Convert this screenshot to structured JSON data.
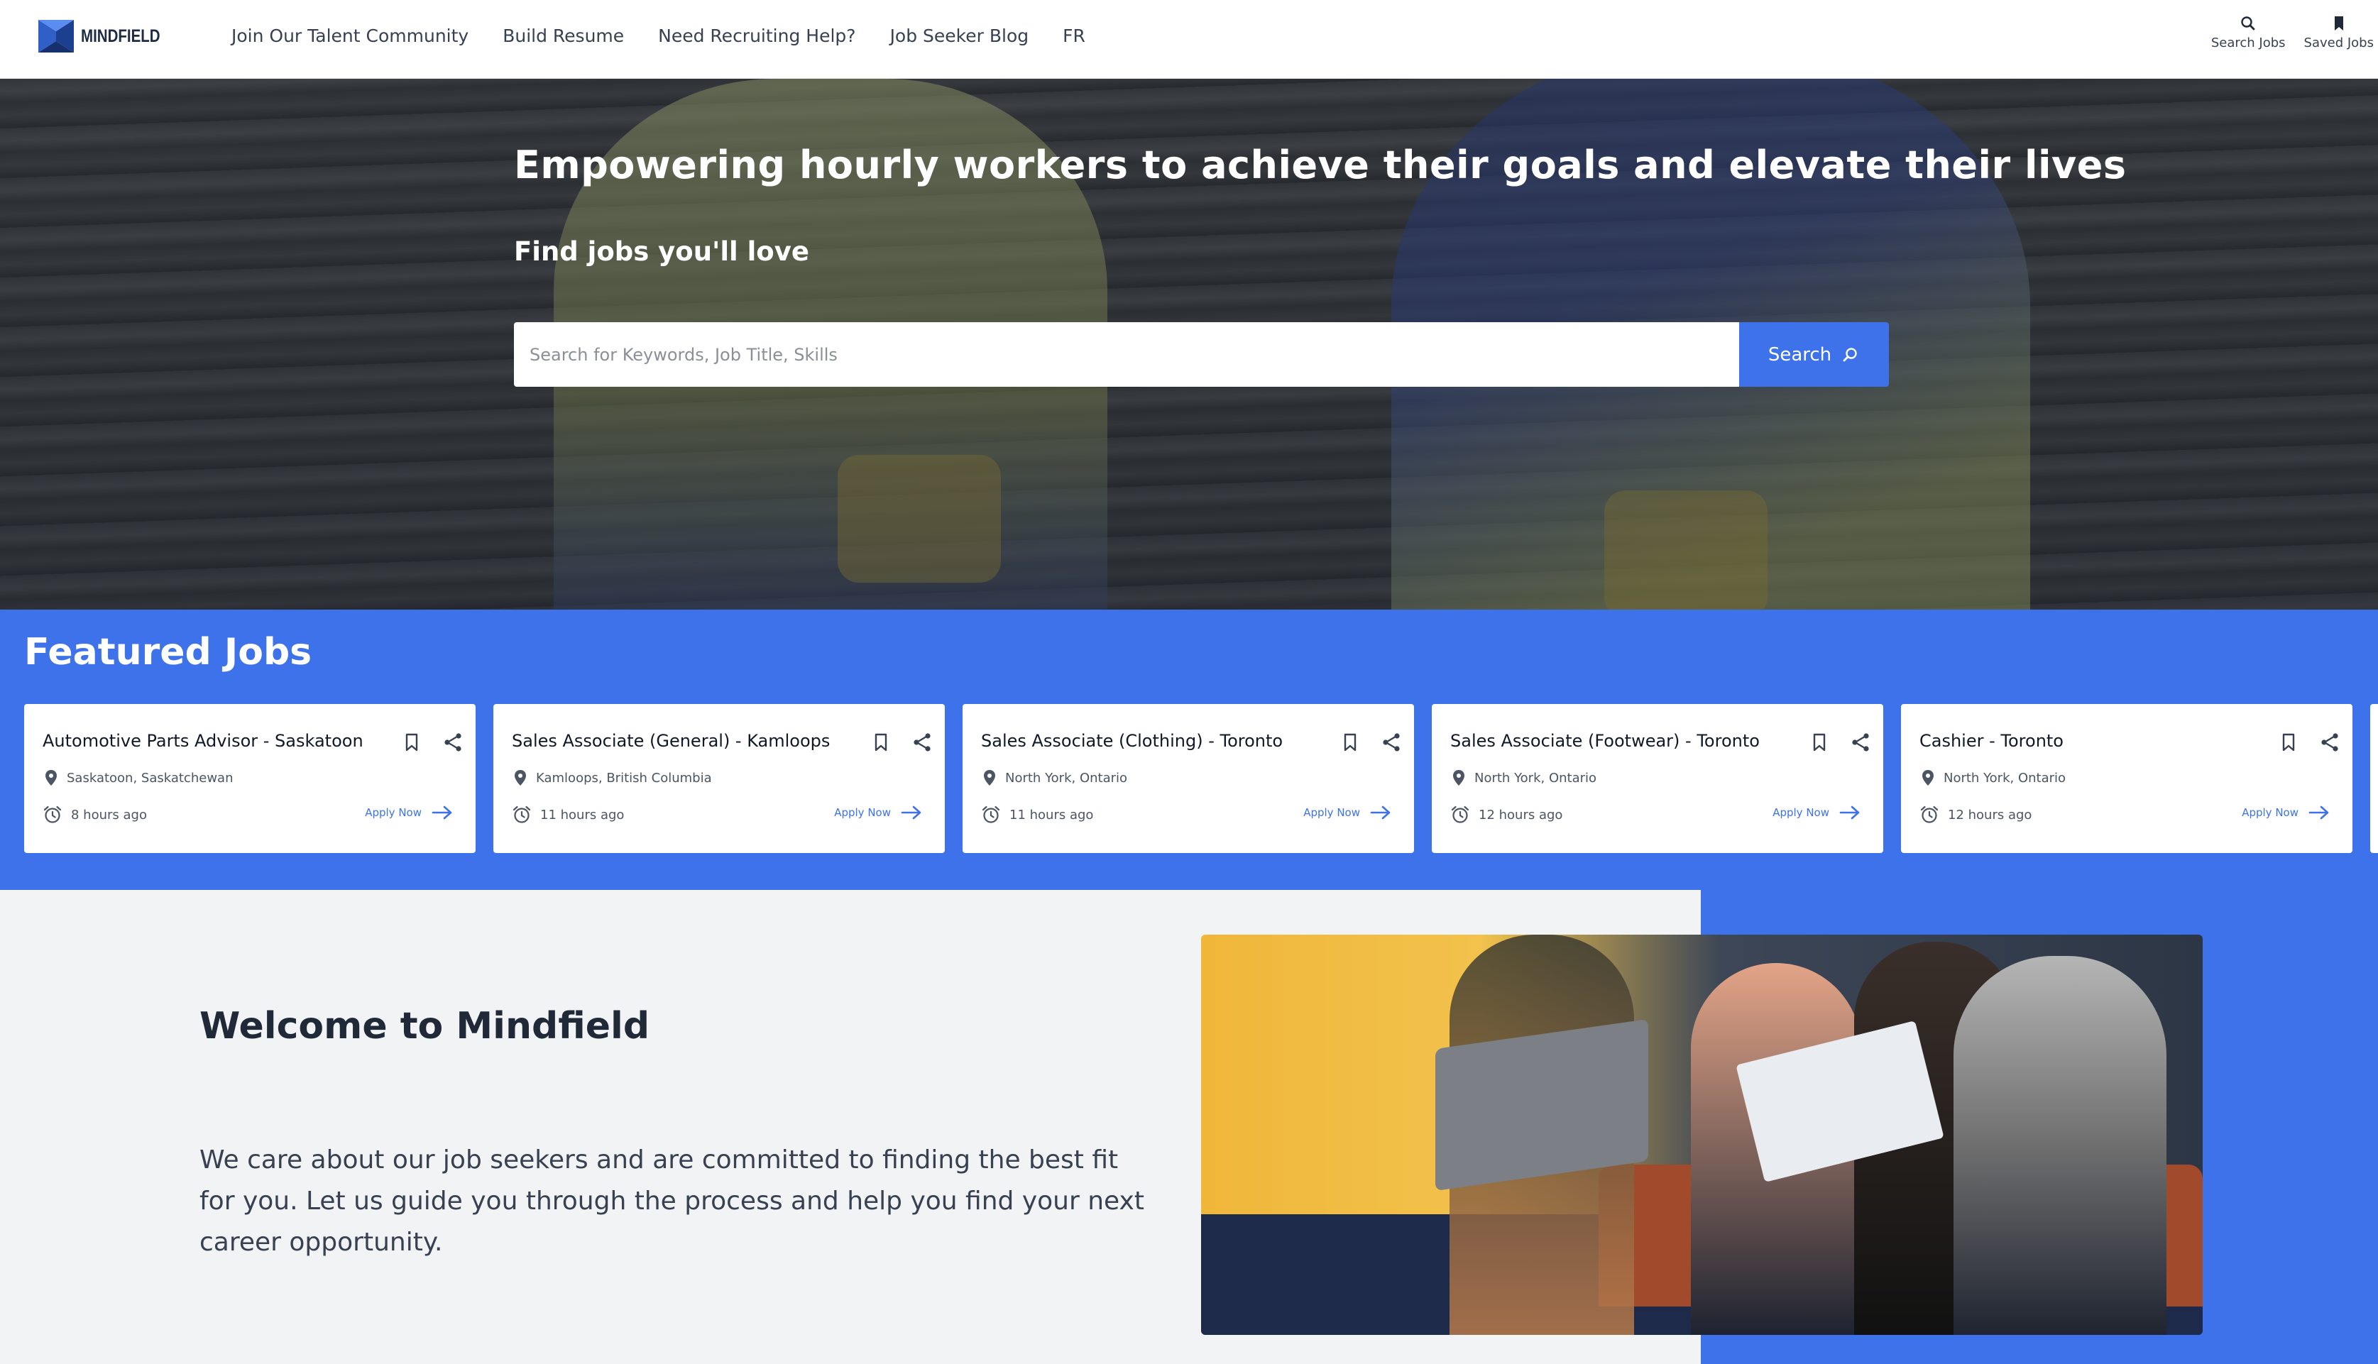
{
  "header": {
    "logo_text": "MINDFIELD",
    "nav": [
      {
        "label": "Join Our Talent Community"
      },
      {
        "label": "Build Resume"
      },
      {
        "label": "Need Recruiting Help?"
      },
      {
        "label": "Job Seeker Blog"
      },
      {
        "label": "FR"
      }
    ],
    "tools": {
      "search_jobs": {
        "label": "Search Jobs",
        "icon": "search-icon"
      },
      "saved_jobs": {
        "label": "Saved Jobs",
        "icon": "bookmark-icon"
      }
    }
  },
  "hero": {
    "title": "Empowering hourly workers to achieve their goals and elevate their lives",
    "subtitle": "Find jobs you'll love",
    "search": {
      "placeholder": "Search for Keywords, Job Title, Skills",
      "value": "",
      "button_label": "Search"
    }
  },
  "featured": {
    "title": "Featured Jobs",
    "apply_label": "Apply Now",
    "jobs": [
      {
        "title": "Automotive Parts Advisor - Saskatoon",
        "location": "Saskatoon, Saskatchewan",
        "posted": "8 hours ago"
      },
      {
        "title": "Sales Associate (General) - Kamloops",
        "location": "Kamloops, British Columbia",
        "posted": "11 hours ago"
      },
      {
        "title": "Sales Associate (Clothing) - Toronto",
        "location": "North York, Ontario",
        "posted": "11 hours ago"
      },
      {
        "title": "Sales Associate (Footwear) - Toronto",
        "location": "North York, Ontario",
        "posted": "12 hours ago"
      },
      {
        "title": "Cashier - Toronto",
        "location": "North York, Ontario",
        "posted": "12 hours ago"
      }
    ]
  },
  "welcome": {
    "title": "Welcome to Mindfield",
    "body": "We care about our job seekers and are committed to finding the best fit for you. Let us guide you through the process and help you find your next career opportunity."
  },
  "colors": {
    "accent": "#3d72ea",
    "page_bg": "#f2f3f5",
    "text_dark": "#1f2937"
  }
}
